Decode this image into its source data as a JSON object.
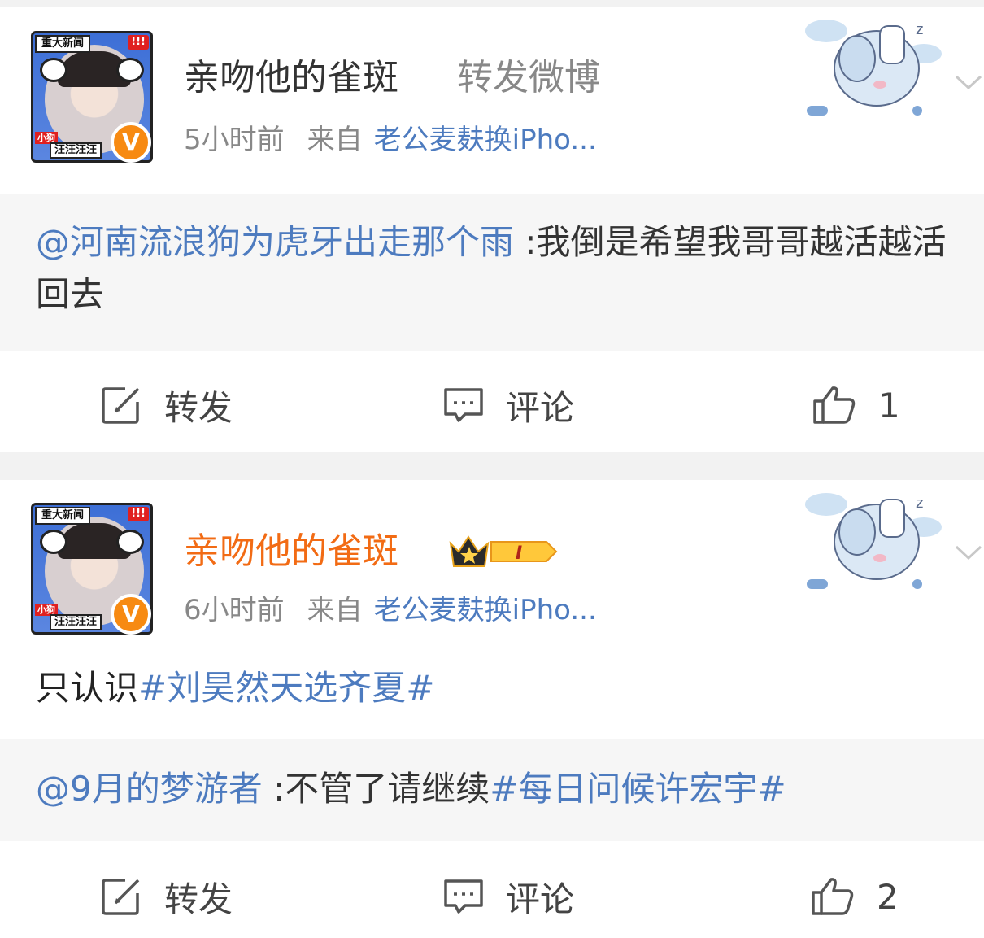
{
  "posts": [
    {
      "author": "亲吻他的雀斑",
      "repost_label": "转发微博",
      "time": "5小时前",
      "from_label": "来自",
      "source": "老公麦麸换iPho...",
      "avatar": {
        "news_tag": "重大新闻",
        "alert_tag": "!!!",
        "dog_tag": "小狗",
        "wang_tag": "汪汪汪汪",
        "verified": "V"
      },
      "quote": {
        "mention": "@河南流浪狗为虎牙出走那个雨",
        "text": " :我倒是希望我哥哥越活越活回去"
      },
      "actions": {
        "repost": "转发",
        "comment": "评论",
        "likes": "1"
      }
    },
    {
      "author": "亲吻他的雀斑",
      "member_level": "I",
      "time": "6小时前",
      "from_label": "来自",
      "source": "老公麦麸换iPho...",
      "avatar": {
        "news_tag": "重大新闻",
        "alert_tag": "!!!",
        "dog_tag": "小狗",
        "wang_tag": "汪汪汪汪",
        "verified": "V"
      },
      "text_prefix": "只认识",
      "text_topic": "#刘昊然天选齐夏#",
      "quote": {
        "mention": "@9月的梦游者",
        "text_plain": " :不管了请继续",
        "text_topic": "#每日问候许宏宇#"
      },
      "actions": {
        "repost": "转发",
        "comment": "评论",
        "likes": "2"
      }
    }
  ],
  "colors": {
    "link": "#4d7bbf",
    "vip_name": "#f26b14",
    "verified": "#f78a12",
    "quote_bg": "#f6f6f6"
  },
  "icons": [
    "repost-icon",
    "comment-icon",
    "like-icon",
    "chevron-down-icon",
    "crown-icon",
    "sleeping-elephant-sticker"
  ]
}
